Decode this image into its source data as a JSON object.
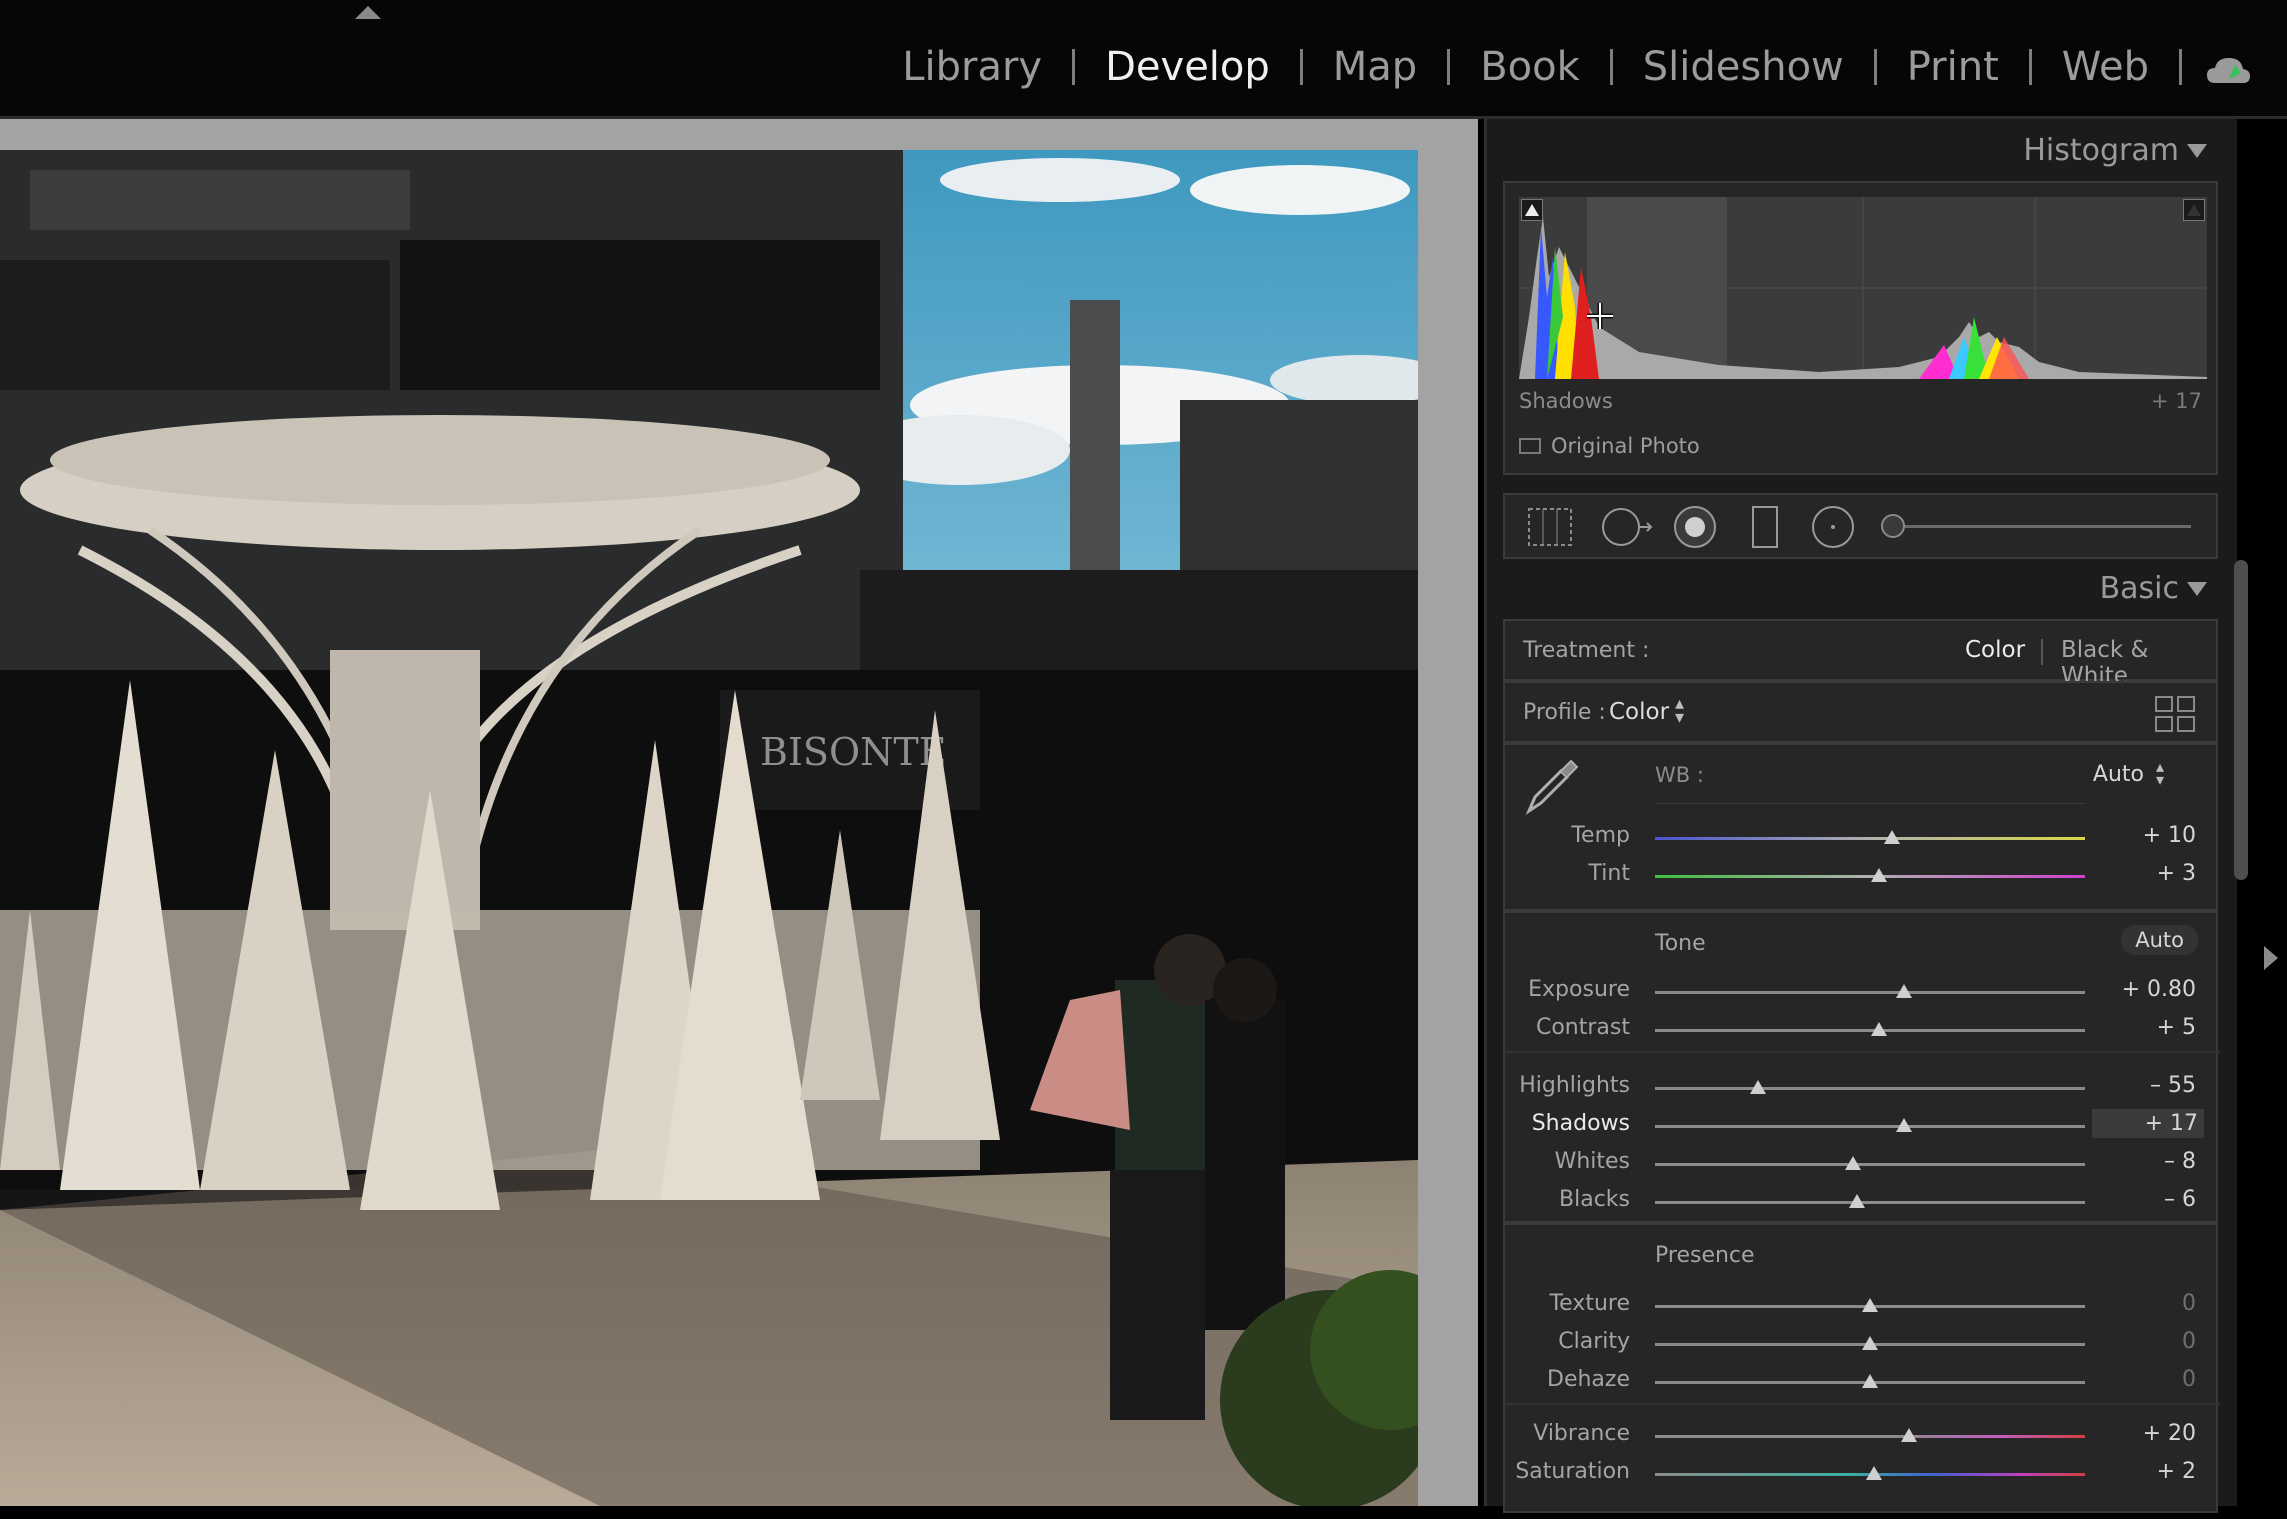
{
  "modules": [
    "Library",
    "Develop",
    "Map",
    "Book",
    "Slideshow",
    "Print",
    "Web"
  ],
  "active_module": "Develop",
  "histogram": {
    "title": "Histogram",
    "info_label": "Shadows",
    "info_value": "+ 17",
    "original_photo_label": "Original Photo"
  },
  "photo": {
    "sign_text": "BISONTE"
  },
  "basic": {
    "title": "Basic",
    "treatment_label": "Treatment :",
    "treatment_color": "Color",
    "treatment_bw": "Black & White",
    "profile_label": "Profile :",
    "profile_value": "Color",
    "wb_label": "WB :",
    "wb_value": "Auto",
    "tone_label": "Tone",
    "tone_auto": "Auto",
    "presence_label": "Presence",
    "sliders": {
      "temp": {
        "label": "Temp",
        "value": "+ 10",
        "level": 0.55
      },
      "tint": {
        "label": "Tint",
        "value": "+ 3",
        "level": 0.52
      },
      "exposure": {
        "label": "Exposure",
        "value": "+ 0.80",
        "level": 0.58
      },
      "contrast": {
        "label": "Contrast",
        "value": "+ 5",
        "level": 0.52
      },
      "highlights": {
        "label": "Highlights",
        "value": "– 55",
        "level": 0.24
      },
      "shadows": {
        "label": "Shadows",
        "value": "+ 17",
        "level": 0.58
      },
      "whites": {
        "label": "Whites",
        "value": "– 8",
        "level": 0.46
      },
      "blacks": {
        "label": "Blacks",
        "value": "– 6",
        "level": 0.47
      },
      "texture": {
        "label": "Texture",
        "value": "0",
        "level": 0.5
      },
      "clarity": {
        "label": "Clarity",
        "value": "0",
        "level": 0.5
      },
      "dehaze": {
        "label": "Dehaze",
        "value": "0",
        "level": 0.5
      },
      "vibrance": {
        "label": "Vibrance",
        "value": "+ 20",
        "level": 0.59
      },
      "saturation": {
        "label": "Saturation",
        "value": "+ 2",
        "level": 0.51
      }
    }
  },
  "colors": {
    "accent": "#f0f0f0",
    "panel": "#1b1b1b",
    "photo_sky": "#4fa7c8"
  }
}
